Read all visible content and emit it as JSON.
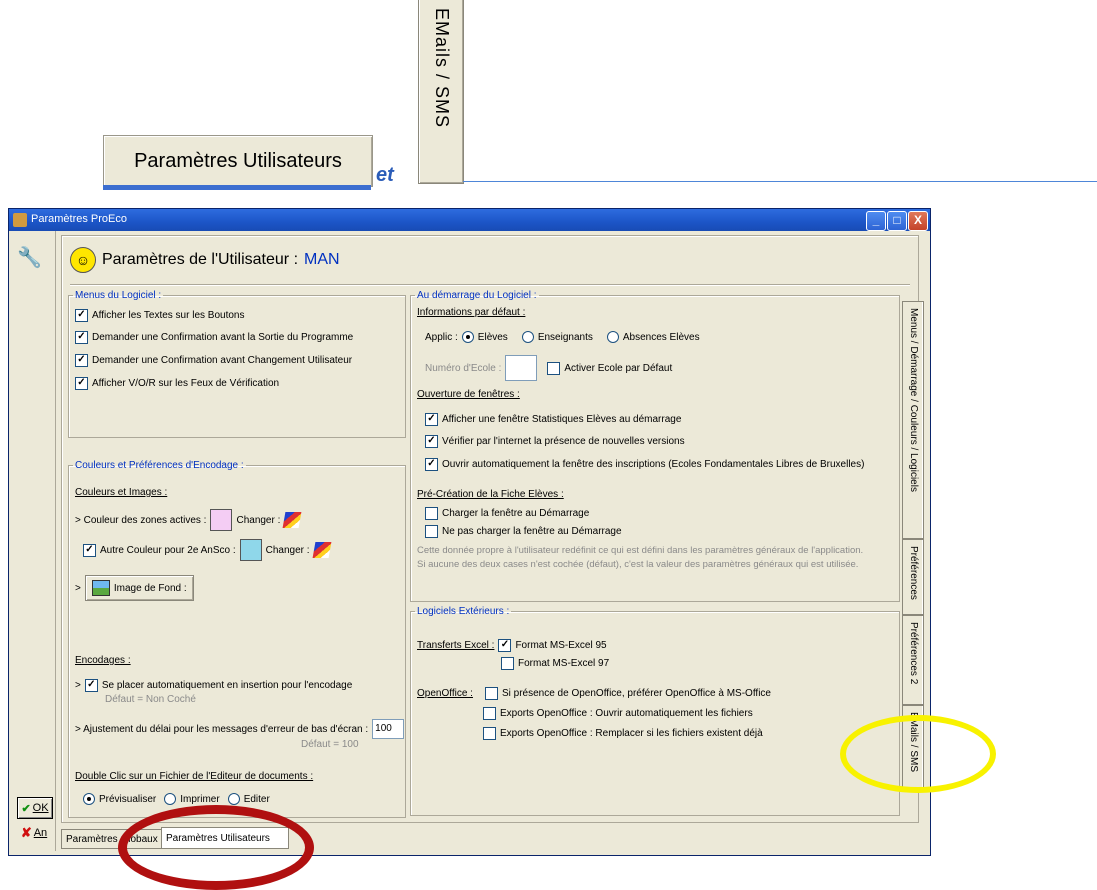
{
  "doc": {
    "user_button_label": "Paramètres Utilisateurs",
    "connector_word": "et",
    "vertical_tab_label": "EMails / SMS"
  },
  "window": {
    "title": "Paramètres ProEco",
    "minimize_glyph": "_",
    "maximize_glyph": "□",
    "close_glyph": "X"
  },
  "header": {
    "title": "Paramètres de l'Utilisateur : ",
    "user": "MAN"
  },
  "menus": {
    "legend": "Menus du Logiciel :",
    "items": [
      {
        "label": "Afficher les Textes sur les Boutons",
        "checked": true
      },
      {
        "label": "Demander une Confirmation avant la Sortie du Programme",
        "checked": true
      },
      {
        "label": "Demander une Confirmation avant Changement Utilisateur",
        "checked": true
      },
      {
        "label": "Afficher V/O/R sur les Feux de Vérification",
        "checked": true
      }
    ]
  },
  "colors": {
    "legend": "Couleurs et Préférences d'Encodage :",
    "images_heading": "Couleurs et Images :",
    "active_zones_label": "> Couleur des zones actives :",
    "active_zone_color": "#f4cdf4",
    "change_label": "Changer :",
    "alt_color_label": "Autre Couleur pour 2e AnSco :",
    "alt_color": "#8fd7ea",
    "alt_color_checked": true,
    "bg_prefix": ">",
    "bg_button_label": "Image de Fond :",
    "encoding_heading": "Encodages :",
    "insert_label": "Se placer automatiquement en insertion pour l'encodage",
    "insert_checked": true,
    "insert_default": "Défaut = Non Coché",
    "delay_label": "> Ajustement du délai pour les messages d'erreur de bas d'écran :",
    "delay_value": "100",
    "delay_default": "Défaut = 100",
    "dblclick_heading": "Double Clic sur un Fichier de l'Editeur de documents :",
    "dblclick_options": [
      {
        "label": "Prévisualiser",
        "selected": true
      },
      {
        "label": "Imprimer",
        "selected": false
      },
      {
        "label": "Editer",
        "selected": false
      }
    ]
  },
  "startup": {
    "legend": "Au démarrage du Logiciel :",
    "defaults_heading": "Informations par défaut :",
    "applic_label": "Applic :",
    "applic_options": [
      {
        "label": "Elèves",
        "selected": true
      },
      {
        "label": "Enseignants",
        "selected": false
      },
      {
        "label": "Absences Elèves",
        "selected": false
      }
    ],
    "school_number_label": "Numéro d'Ecole :",
    "activate_school_label": "Activer Ecole par Défaut",
    "windows_heading": "Ouverture de fenêtres :",
    "windows_items": [
      {
        "label": "Afficher une fenêtre Statistiques Elèves au démarrage",
        "checked": true
      },
      {
        "label": "Vérifier par l'internet la présence de nouvelles versions",
        "checked": true
      },
      {
        "label": "Ouvrir automatiquement la fenêtre des inscriptions (Ecoles Fondamentales Libres de Bruxelles)",
        "checked": true
      }
    ],
    "precreation_heading": "Pré-Création de la Fiche Elèves :",
    "precreation_items": [
      {
        "label": "Charger la fenêtre au Démarrage",
        "checked": false
      },
      {
        "label": "Ne pas charger la fenêtre au Démarrage",
        "checked": false
      }
    ],
    "note_line1": "Cette donnée propre à l'utilisateur redéfinit ce qui est défini dans les paramètres généraux de l'application.",
    "note_line2": "Si aucune des deux cases n'est cochée (défaut), c'est la valeur des paramètres généraux qui est utilisée."
  },
  "external": {
    "legend": "Logiciels Extérieurs :",
    "excel_label": "Transferts Excel :",
    "excel_options": [
      {
        "label": "Format MS-Excel 95",
        "checked": true
      },
      {
        "label": "Format MS-Excel 97",
        "checked": false
      }
    ],
    "openoffice_label": "OpenOffice :",
    "openoffice_options": [
      {
        "label": "Si présence de OpenOffice, préférer OpenOffice à MS-Office",
        "checked": false
      },
      {
        "label": "Exports OpenOffice : Ouvrir automatiquement les fichiers",
        "checked": false
      },
      {
        "label": "Exports OpenOffice  : Remplacer si les fichiers existent déjà",
        "checked": false
      }
    ]
  },
  "side_tabs": [
    "Menus / Démarrage / Couleurs / Logiciels",
    "Préférences",
    "Préférences 2",
    "EMails / SMS"
  ],
  "bottom_tabs": [
    "Paramètres Globaux",
    "Paramètres Utilisateurs"
  ],
  "buttons": {
    "ok": "OK",
    "cancel": "An"
  },
  "highlight_colors": {
    "yellow": "#f8f200",
    "red": "#b01010"
  }
}
